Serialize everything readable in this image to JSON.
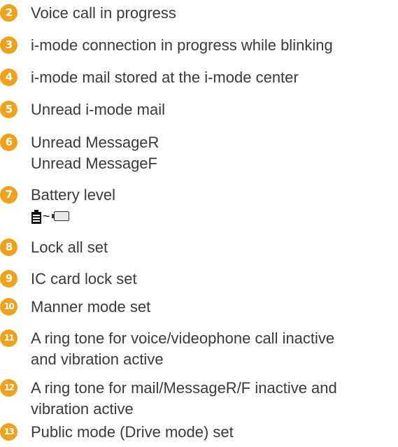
{
  "items": [
    {
      "number": "2",
      "lines": [
        "Voice call in progress"
      ]
    },
    {
      "number": "3",
      "lines": [
        "i-mode connection in progress while blinking"
      ]
    },
    {
      "number": "4",
      "lines": [
        "i-mode mail stored at the i-mode center"
      ]
    },
    {
      "number": "5",
      "lines": [
        "Unread i-mode mail"
      ]
    },
    {
      "number": "6",
      "lines": [
        "Unread MessageR",
        "Unread MessageF"
      ]
    },
    {
      "number": "7",
      "lines": [
        "Battery level"
      ],
      "icons": [
        "battery-full-icon",
        "battery-empty-icon"
      ],
      "icon_separator": "~"
    },
    {
      "number": "8",
      "lines": [
        "Lock all set"
      ]
    },
    {
      "number": "9",
      "lines": [
        "IC card lock set"
      ]
    },
    {
      "number": "10",
      "lines": [
        "Manner mode set"
      ]
    },
    {
      "number": "11",
      "lines": [
        "A ring tone for voice/videophone call inactive",
        "and vibration active"
      ]
    },
    {
      "number": "12",
      "lines": [
        "A ring tone for mail/MessageR/F inactive and",
        "vibration active"
      ]
    },
    {
      "number": "13",
      "lines": [
        "Public mode (Drive mode) set"
      ]
    }
  ],
  "colors": {
    "badge": "#f0a11a",
    "text": "#3a3a3a"
  }
}
